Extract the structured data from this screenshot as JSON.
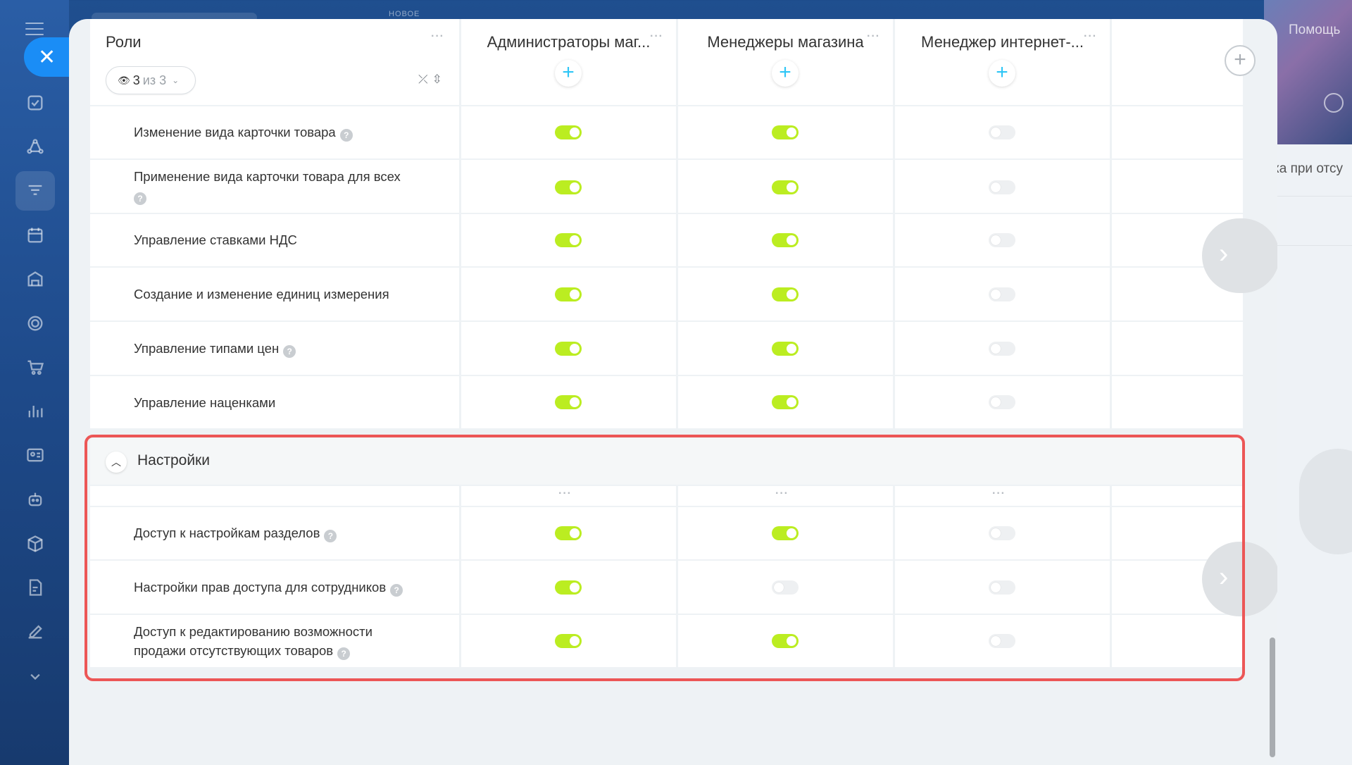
{
  "top": {
    "new_label": "НОВОЕ",
    "help_label": "Помощь"
  },
  "right_fragment": {
    "text": "ка при отсу"
  },
  "sidebar": {
    "icons": [
      "tasks-icon",
      "crm-icon",
      "catalog-icon",
      "calendar-icon",
      "store-icon",
      "target-icon",
      "cart-icon",
      "analytics-icon",
      "contacts-icon",
      "robot-icon",
      "box-icon",
      "document-icon",
      "sign-icon",
      "more-icon"
    ]
  },
  "header": {
    "roles_title": "Роли",
    "visibility": {
      "count": "3",
      "of_text": "из 3"
    },
    "columns": [
      {
        "title": "Администраторы маг..."
      },
      {
        "title": "Менеджеры магазина"
      },
      {
        "title": "Менеджер интернет-..."
      }
    ]
  },
  "rows_top": [
    {
      "label": "Изменение вида карточки товара",
      "help": true,
      "values": [
        true,
        true,
        false
      ]
    },
    {
      "label": "Применение вида карточки товара для всех",
      "help": true,
      "help_newline": true,
      "values": [
        true,
        true,
        false
      ]
    },
    {
      "label": "Управление ставками НДС",
      "help": false,
      "values": [
        true,
        true,
        false
      ]
    },
    {
      "label": "Создание и изменение единиц измерения",
      "help": false,
      "values": [
        true,
        true,
        false
      ]
    },
    {
      "label": "Управление типами цен",
      "help": true,
      "values": [
        true,
        true,
        false
      ]
    },
    {
      "label": "Управление наценками",
      "help": false,
      "values": [
        true,
        true,
        false
      ]
    }
  ],
  "section": {
    "title": "Настройки",
    "rows": [
      {
        "label": "Доступ к настройкам разделов",
        "help": true,
        "values": [
          true,
          true,
          false
        ]
      },
      {
        "label": "Настройки прав доступа для сотрудников",
        "help": true,
        "values": [
          true,
          false,
          false
        ]
      },
      {
        "label_line1": "Доступ к редактированию возможности",
        "label_line2": "продажи отсутствующих товаров",
        "help": true,
        "values": [
          true,
          true,
          false
        ]
      }
    ]
  },
  "colors": {
    "toggle_on": "#bbed21",
    "toggle_off": "#eef0f2",
    "accent": "#2fc6f6",
    "highlight": "#ec5656"
  }
}
